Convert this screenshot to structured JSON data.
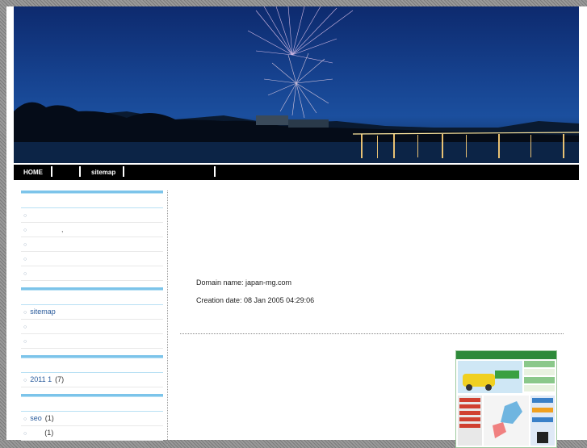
{
  "nav": {
    "items": [
      {
        "label": "HOME"
      },
      {
        "label": ""
      },
      {
        "label": "sitemap"
      },
      {
        "label": ""
      }
    ]
  },
  "sidebar": {
    "group1": {
      "items": [
        {
          "label": ""
        },
        {
          "label": ""
        },
        {
          "label": ""
        },
        {
          "label": ""
        },
        {
          "label": ""
        }
      ],
      "comma": ","
    },
    "group2": {
      "items": [
        {
          "label": "sitemap"
        },
        {
          "label": ""
        },
        {
          "label": ""
        }
      ]
    },
    "group3": {
      "items": [
        {
          "label": "2011 1",
          "count": "(7)"
        }
      ]
    },
    "group4": {
      "items": [
        {
          "label": "seo",
          "count": "(1)"
        },
        {
          "label": "",
          "count": "(1)"
        }
      ]
    }
  },
  "main": {
    "domain_line": "Domain name: japan-mg.com",
    "creation_line": "Creation date: 08 Jan 2005 04:29:06"
  },
  "colors": {
    "accent": "#7cc4ea",
    "link": "#2a5b9c",
    "nav_bg": "#000000"
  }
}
